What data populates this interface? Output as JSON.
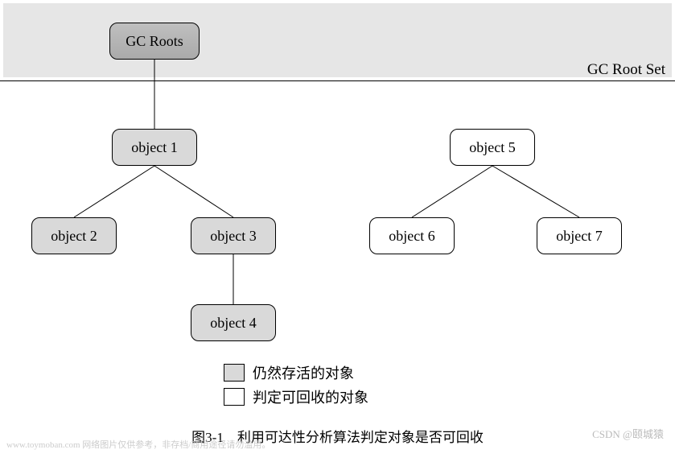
{
  "header": {
    "root_set_label": "GC Root Set"
  },
  "nodes": {
    "gc_roots": "GC Roots",
    "object1": "object 1",
    "object2": "object 2",
    "object3": "object 3",
    "object4": "object 4",
    "object5": "object 5",
    "object6": "object 6",
    "object7": "object 7"
  },
  "legend": {
    "alive": "仍然存活的对象",
    "collectible": "判定可回收的对象"
  },
  "caption": "图3-1　利用可达性分析算法判定对象是否可回收",
  "watermarks": {
    "left": "www.toymoban.com 网络图片仅供参考，非存档/商用途径请勿滥用。",
    "right": "CSDN @颐城猿"
  },
  "chart_data": {
    "type": "diagram",
    "title": "图3-1 利用可达性分析算法判定对象是否可回收",
    "root_set": [
      "GC Roots"
    ],
    "nodes": [
      {
        "id": "gc_roots",
        "label": "GC Roots",
        "state": "root"
      },
      {
        "id": "object1",
        "label": "object 1",
        "state": "alive"
      },
      {
        "id": "object2",
        "label": "object 2",
        "state": "alive"
      },
      {
        "id": "object3",
        "label": "object 3",
        "state": "alive"
      },
      {
        "id": "object4",
        "label": "object 4",
        "state": "alive"
      },
      {
        "id": "object5",
        "label": "object 5",
        "state": "collectible"
      },
      {
        "id": "object6",
        "label": "object 6",
        "state": "collectible"
      },
      {
        "id": "object7",
        "label": "object 7",
        "state": "collectible"
      }
    ],
    "edges": [
      {
        "from": "gc_roots",
        "to": "object1"
      },
      {
        "from": "object1",
        "to": "object2"
      },
      {
        "from": "object1",
        "to": "object3"
      },
      {
        "from": "object3",
        "to": "object4"
      },
      {
        "from": "object5",
        "to": "object6"
      },
      {
        "from": "object5",
        "to": "object7"
      }
    ],
    "legend": {
      "alive": "仍然存活的对象",
      "collectible": "判定可回收的对象"
    }
  }
}
